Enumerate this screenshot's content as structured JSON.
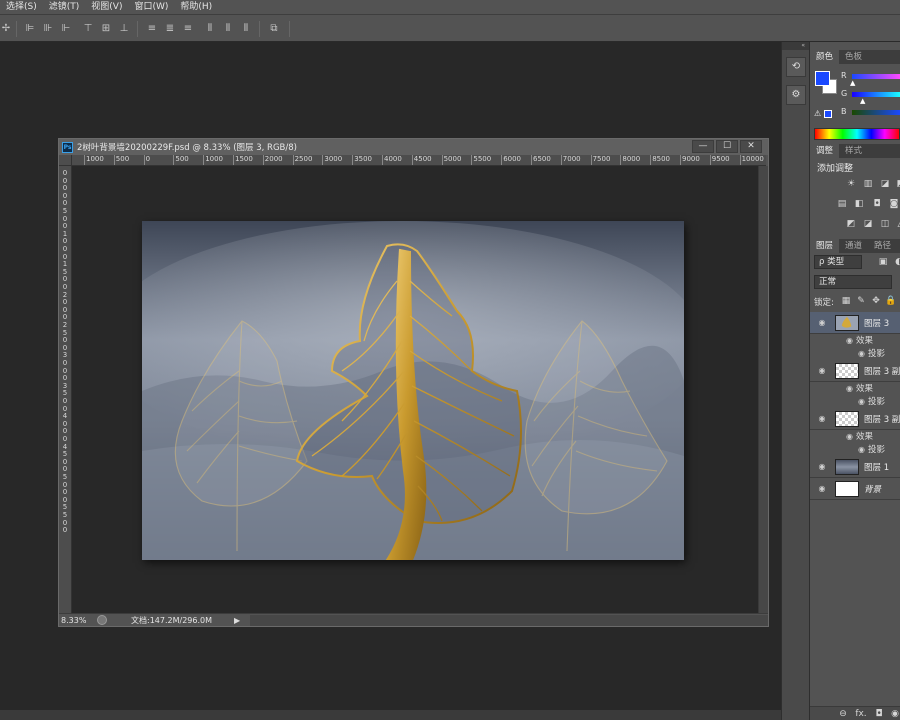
{
  "menu": [
    "选择(S)",
    "滤镜(T)",
    "视图(V)",
    "窗口(W)",
    "帮助(H)"
  ],
  "document": {
    "title": "2树叶背景墙20200229F.psd @ 8.33% (图层 3, RGB/8)",
    "zoom": "8.33%",
    "doc_size": "文档:147.2M/296.0M",
    "ruler_h_labels": [
      "1000",
      "500",
      "0",
      "500",
      "1000",
      "1500",
      "2000",
      "2500",
      "3000",
      "3500",
      "4000",
      "4500",
      "5000",
      "5500",
      "6000",
      "6500",
      "7000",
      "7500",
      "8000",
      "8500",
      "9000",
      "9500",
      "10000"
    ],
    "ruler_v_labels": [
      "0",
      "0",
      "0",
      "0",
      "0",
      "5",
      "0",
      "0",
      "1",
      "0",
      "0",
      "0",
      "1",
      "5",
      "0",
      "0",
      "2",
      "0",
      "0",
      "0",
      "2",
      "5",
      "0",
      "0",
      "3",
      "0",
      "0",
      "0",
      "3",
      "5",
      "0",
      "0",
      "4",
      "0",
      "0",
      "0",
      "4",
      "5",
      "0",
      "0",
      "5",
      "0",
      "0",
      "0",
      "5",
      "5",
      "0",
      "0"
    ],
    "window_buttons": [
      "—",
      "☐",
      "✕"
    ],
    "status_arrow": "▶"
  },
  "panels": {
    "color_tabs": [
      "颜色",
      "色板"
    ],
    "color_channels": [
      "R",
      "G",
      "B"
    ],
    "adjust_tabs": [
      "调整",
      "样式"
    ],
    "adjust_title": "添加调整",
    "adjust_icons_row1": [
      "☀",
      "▥",
      "◪",
      "◩"
    ],
    "adjust_icons_row2": [
      "▤",
      "◧",
      "◘",
      "◙"
    ],
    "adjust_icons_row3": [
      "◩",
      "◪",
      "◫",
      "◬"
    ],
    "layers_tabs": [
      "图层",
      "通道",
      "路径"
    ],
    "filter_kind": "ρ 类型",
    "blend_mode": "正常",
    "lock_label": "锁定:",
    "lock_icons": [
      "▦",
      "✎",
      "✥",
      "🔒"
    ],
    "layers": [
      {
        "name": "图层 3",
        "selected": true,
        "thumb": "leaf",
        "effects": [
          "效果",
          "投影"
        ]
      },
      {
        "name": "图层 3 副",
        "selected": false,
        "thumb": "checker",
        "effects": [
          "效果",
          "投影"
        ]
      },
      {
        "name": "图层 3 副",
        "selected": false,
        "thumb": "checker",
        "effects": [
          "效果",
          "投影"
        ]
      },
      {
        "name": "图层 1",
        "selected": false,
        "thumb": "landscape",
        "effects": []
      },
      {
        "name": "背景",
        "selected": false,
        "thumb": "white",
        "effects": []
      }
    ],
    "footer_icons": [
      "⊖",
      "fx.",
      "◘",
      "◉"
    ]
  },
  "colors": {
    "foreground": "#1a49ff",
    "background": "#ffffff",
    "selection": "#566072",
    "gold": "#d4a93a"
  }
}
